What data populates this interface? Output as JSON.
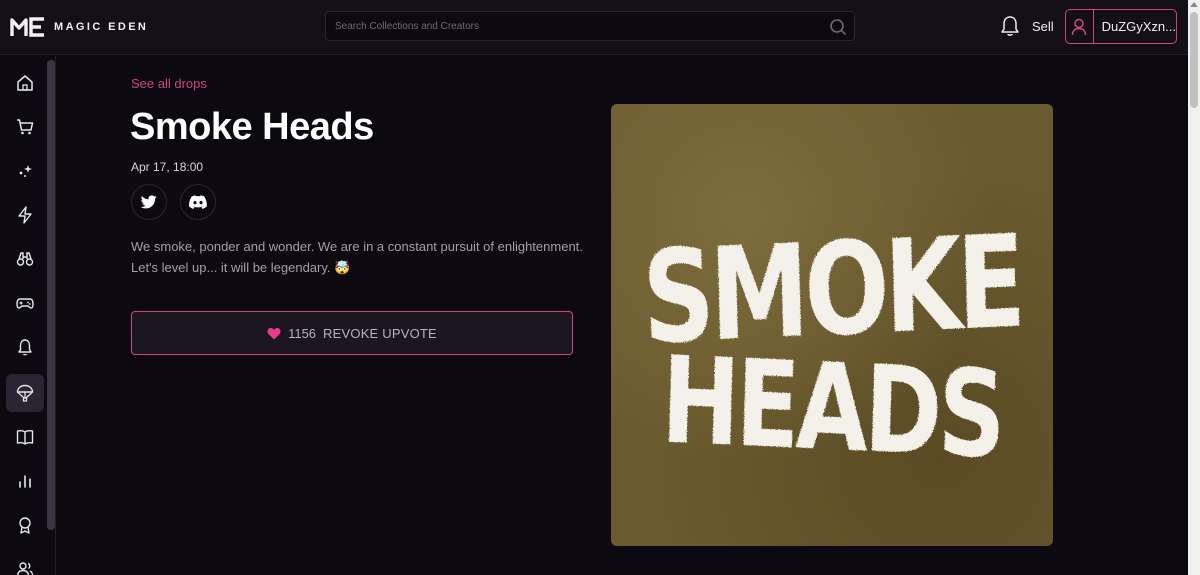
{
  "header": {
    "brand": "MAGIC EDEN",
    "search_placeholder": "Search Collections and Creators",
    "sell_label": "Sell",
    "user_name": "DuZGyXzn..."
  },
  "sidebar": {
    "items": [
      {
        "name": "home-icon",
        "active": false
      },
      {
        "name": "cart-icon",
        "active": false
      },
      {
        "name": "sparkles-icon",
        "active": false
      },
      {
        "name": "lightning-icon",
        "active": false
      },
      {
        "name": "binoculars-icon",
        "active": false
      },
      {
        "name": "gamepad-icon",
        "active": false
      },
      {
        "name": "bell-icon",
        "active": false
      },
      {
        "name": "parachute-icon",
        "active": true
      },
      {
        "name": "book-icon",
        "active": false
      },
      {
        "name": "bar-chart-icon",
        "active": false
      },
      {
        "name": "award-icon",
        "active": false
      },
      {
        "name": "users-icon",
        "active": false
      }
    ]
  },
  "drop": {
    "back_link": "See all drops",
    "title": "Smoke Heads",
    "date": "Apr 17, 18:00",
    "description": "We smoke, ponder and wonder. We are in a constant pursuit of enlightenment. Let's level up... it will be legendary. 🤯",
    "upvote_count": "1156",
    "upvote_label": "REVOKE UPVOTE",
    "art_line1": "SMOKE",
    "art_line2": "HEADS"
  },
  "colors": {
    "accent": "#d1457c",
    "background": "#0c0a10",
    "topbar": "#130f19",
    "art_background": "#6a5a2f"
  }
}
